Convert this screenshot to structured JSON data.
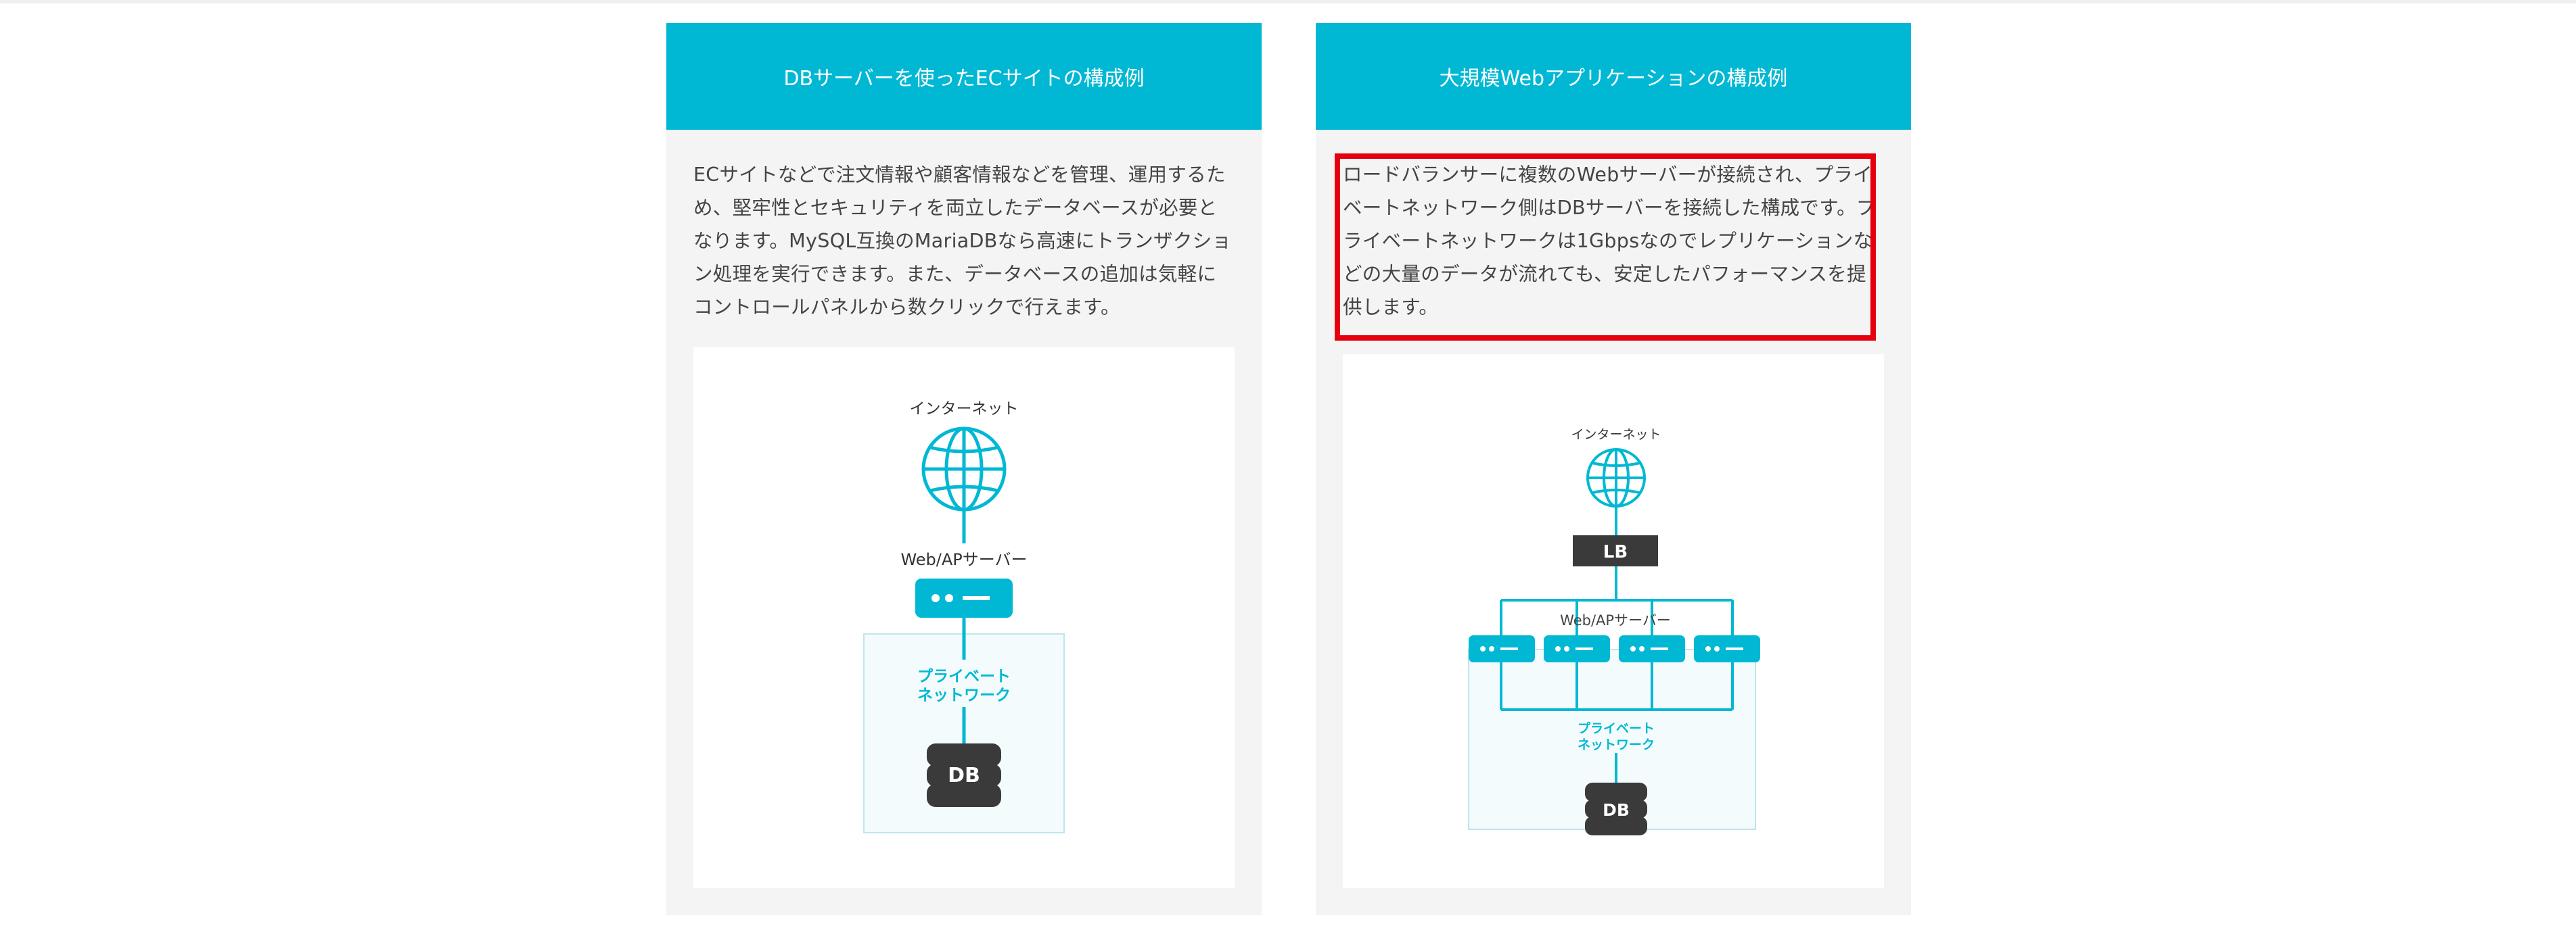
{
  "colors": {
    "accent": "#00b8d4",
    "dark": "#3a3a3a",
    "highlight": "#e6000f",
    "panel": "#f4f4f4"
  },
  "cards": [
    {
      "title": "DBサーバーを使ったECサイトの構成例",
      "text": "ECサイトなどで注文情報や顧客情報などを管理、運用するため、堅牢性とセキュリティを両立したデータベースが必要となります。MySQL互換のMariaDBなら高速にトランザクション処理を実行できます。また、データベースの追加は気軽にコントロールパネルから数クリックで行えます。",
      "diagram": {
        "internet_label": "インターネット",
        "server_label": "Web/APサーバー",
        "network_label_line1": "プライベート",
        "network_label_line2": "ネットワーク",
        "db_label": "DB",
        "icons": [
          "globe-icon",
          "server-icon",
          "database-icon"
        ]
      }
    },
    {
      "title": "大規模Webアプリケーションの構成例",
      "text": "ロードバランサーに複数のWebサーバーが接続され、プライベートネットワーク側はDBサーバーを接続した構成です。プライベートネットワークは1Gbpsなのでレプリケーションなどの大量のデータが流れても、安定したパフォーマンスを提供します。",
      "diagram": {
        "internet_label": "インターネット",
        "lb_label": "LB",
        "server_label": "Web/APサーバー",
        "network_label_line1": "プライベート",
        "network_label_line2": "ネットワーク",
        "db_label": "DB",
        "icons": [
          "globe-icon",
          "load-balancer-icon",
          "server-icon",
          "database-icon"
        ]
      }
    }
  ]
}
